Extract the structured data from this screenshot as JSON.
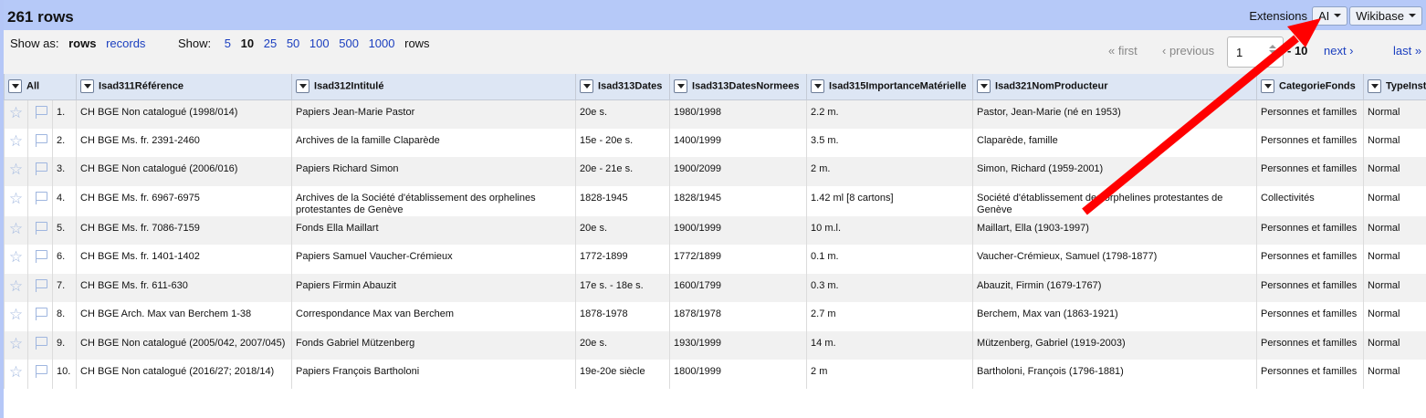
{
  "summary": {
    "rows_count": "261 rows"
  },
  "extensions": {
    "label": "Extensions",
    "ai_label": "AI",
    "wikibase_label": "Wikibase"
  },
  "view": {
    "show_as_label": "Show as:",
    "rows_label": "rows",
    "records_label": "records",
    "show_label": "Show:",
    "page_sizes": [
      "5",
      "10",
      "25",
      "50",
      "100",
      "500",
      "1000"
    ],
    "selected_page_size": "10",
    "rows_suffix": "rows"
  },
  "pager": {
    "first": "« first",
    "previous": "‹ previous",
    "page_value": "1",
    "of_text": "- 10",
    "next": "next ›",
    "last": "last »"
  },
  "columns": {
    "all": "All",
    "ref": "Isad311Référence",
    "title": "Isad312Intitulé",
    "dates": "Isad313Dates",
    "norm": "Isad313DatesNormees",
    "size": "Isad315ImportanceMatérielle",
    "producer": "Isad321NomProducteur",
    "cat": "CategorieFonds",
    "type": "TypeInst"
  },
  "rows": [
    {
      "num": "1.",
      "ref": "CH BGE Non catalogué (1998/014)",
      "title": "Papiers Jean-Marie Pastor",
      "dates": "20e s.",
      "norm": "1980/1998",
      "size": "2.2 m.",
      "producer": "Pastor, Jean-Marie (né en 1953)",
      "cat": "Personnes et familles",
      "type": "Normal"
    },
    {
      "num": "2.",
      "ref": "CH BGE Ms. fr. 2391-2460",
      "title": "Archives de la famille Claparède",
      "dates": "15e - 20e s.",
      "norm": "1400/1999",
      "size": "3.5 m.",
      "producer": "Claparède, famille",
      "cat": "Personnes et familles",
      "type": "Normal"
    },
    {
      "num": "3.",
      "ref": "CH BGE Non catalogué (2006/016)",
      "title": "Papiers Richard Simon",
      "dates": "20e - 21e s.",
      "norm": "1900/2099",
      "size": "2 m.",
      "producer": "Simon, Richard (1959-2001)",
      "cat": "Personnes et familles",
      "type": "Normal"
    },
    {
      "num": "4.",
      "ref": "CH BGE Ms. fr. 6967-6975",
      "title": "Archives de la Société d'établissement des orphelines protestantes de Genève",
      "dates": "1828-1945",
      "norm": "1828/1945",
      "size": "1.42 ml [8 cartons]",
      "producer": "Société d'établissement des orphelines protestantes de Genève",
      "cat": "Collectivités",
      "type": "Normal"
    },
    {
      "num": "5.",
      "ref": "CH BGE Ms. fr. 7086-7159",
      "title": "Fonds Ella Maillart",
      "dates": "20e s.",
      "norm": "1900/1999",
      "size": "10 m.l.",
      "producer": "Maillart, Ella (1903-1997)",
      "cat": "Personnes et familles",
      "type": "Normal"
    },
    {
      "num": "6.",
      "ref": "CH BGE Ms. fr. 1401-1402",
      "title": "Papiers Samuel Vaucher-Crémieux",
      "dates": "1772-1899",
      "norm": "1772/1899",
      "size": "0.1 m.",
      "producer": "Vaucher-Crémieux, Samuel (1798-1877)",
      "cat": "Personnes et familles",
      "type": "Normal"
    },
    {
      "num": "7.",
      "ref": "CH BGE Ms. fr. 611-630",
      "title": "Papiers Firmin Abauzit",
      "dates": "17e s. - 18e s.",
      "norm": "1600/1799",
      "size": "0.3 m.",
      "producer": "Abauzit, Firmin (1679-1767)",
      "cat": "Personnes et familles",
      "type": "Normal"
    },
    {
      "num": "8.",
      "ref": "CH BGE Arch. Max van Berchem 1-38",
      "title": "Correspondance Max van Berchem",
      "dates": "1878-1978",
      "norm": "1878/1978",
      "size": "2.7 m",
      "producer": "Berchem, Max van (1863-1921)",
      "cat": "Personnes et familles",
      "type": "Normal"
    },
    {
      "num": "9.",
      "ref": "CH BGE Non catalogué (2005/042, 2007/045)",
      "title": "Fonds Gabriel Mützenberg",
      "dates": "20e s.",
      "norm": "1930/1999",
      "size": "14 m.",
      "producer": "Mützenberg, Gabriel (1919-2003)",
      "cat": "Personnes et familles",
      "type": "Normal"
    },
    {
      "num": "10.",
      "ref": "CH BGE Non catalogué (2016/27; 2018/14)",
      "title": "Papiers François Bartholoni",
      "dates": "19e-20e siècle",
      "norm": "1800/1999",
      "size": "2 m",
      "producer": "Bartholoni, François (1796-1881)",
      "cat": "Personnes et familles",
      "type": "Normal"
    }
  ],
  "icons": {
    "star": "star-icon",
    "flag": "flag-icon",
    "column_menu": "column-menu-icon"
  },
  "colors": {
    "summary_bar": "#b6c9f8",
    "header_bg": "#dde6f4",
    "link": "#1b3fbf",
    "annotation_arrow": "#ff0000"
  }
}
